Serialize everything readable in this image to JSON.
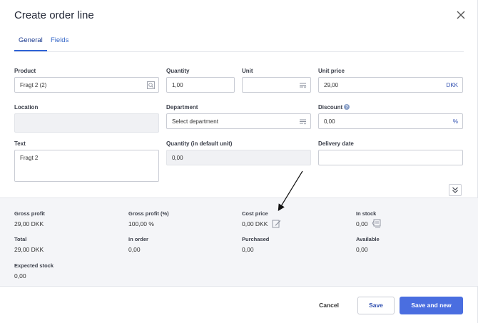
{
  "dialog": {
    "title": "Create order line",
    "close_icon": "close-icon"
  },
  "tabs": [
    {
      "label": "General",
      "active": true
    },
    {
      "label": "Fields",
      "active": false
    }
  ],
  "form": {
    "product": {
      "label": "Product",
      "value": "Fragt 2 (2)",
      "icon": "search-icon"
    },
    "quantity": {
      "label": "Quantity",
      "value": "1,00"
    },
    "unit": {
      "label": "Unit",
      "value": "",
      "icon": "list-icon"
    },
    "unit_price": {
      "label": "Unit price",
      "value": "29,00",
      "suffix": "DKK"
    },
    "location": {
      "label": "Location",
      "value": ""
    },
    "department": {
      "label": "Department",
      "value": "Select department",
      "icon": "list-icon"
    },
    "discount": {
      "label": "Discount",
      "value": "0,00",
      "suffix": "%",
      "icon": "help-icon"
    },
    "text": {
      "label": "Text",
      "value": "Fragt 2"
    },
    "quantity_default_unit": {
      "label": "Quantity (in default unit)",
      "value": "0,00"
    },
    "delivery_date": {
      "label": "Delivery date",
      "value": ""
    }
  },
  "summary": {
    "gross_profit": {
      "label": "Gross profit",
      "value": "29,00 DKK"
    },
    "gross_profit_pct": {
      "label": "Gross profit (%)",
      "value": "100,00 %"
    },
    "cost_price": {
      "label": "Cost price",
      "value": "0,00 DKK",
      "icon": "edit-icon"
    },
    "in_stock": {
      "label": "In stock",
      "value": "0,00",
      "icon": "stock-list-icon"
    },
    "total": {
      "label": "Total",
      "value": "29,00 DKK"
    },
    "in_order": {
      "label": "In order",
      "value": "0,00"
    },
    "purchased": {
      "label": "Purchased",
      "value": "0,00"
    },
    "available": {
      "label": "Available",
      "value": "0,00"
    },
    "expected_stock": {
      "label": "Expected stock",
      "value": "0,00"
    }
  },
  "footer": {
    "cancel_label": "Cancel",
    "save_label": "Save",
    "save_new_label": "Save and new"
  },
  "colors": {
    "accent": "#4a6ee0",
    "tab_active": "#2f63d6",
    "summary_bg": "#f4f5f8"
  }
}
